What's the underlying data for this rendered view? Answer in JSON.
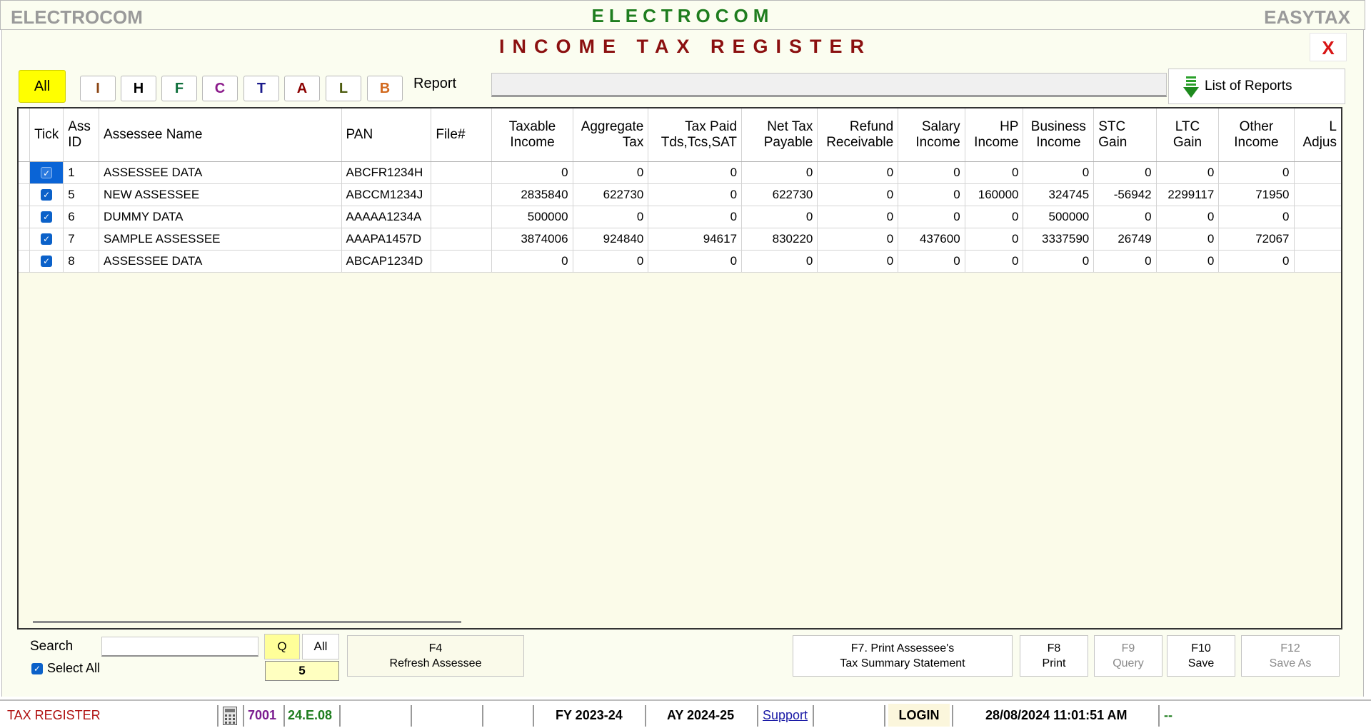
{
  "title_bar": {
    "left": "ELECTROCOM",
    "center": "ELECTROCOM",
    "right": "EASYTAX"
  },
  "register_title": "INCOME TAX REGISTER",
  "close_label": "X",
  "filters": {
    "all": "All",
    "letters": [
      {
        "label": "I",
        "color": "#8b4513"
      },
      {
        "label": "H",
        "color": "#000000"
      },
      {
        "label": "F",
        "color": "#0d6e3a"
      },
      {
        "label": "C",
        "color": "#8b1a8b"
      },
      {
        "label": "T",
        "color": "#1a1a8b"
      },
      {
        "label": "A",
        "color": "#8b0000"
      },
      {
        "label": "L",
        "color": "#4b5a0d"
      },
      {
        "label": "B",
        "color": "#d2691e"
      }
    ]
  },
  "report_label": "Report",
  "report_value": "",
  "list_reports_label": "List of Reports",
  "columns": [
    {
      "line1": "Tick",
      "line2": ""
    },
    {
      "line1": "Ass",
      "line2": "ID"
    },
    {
      "line1": "Assessee Name",
      "line2": ""
    },
    {
      "line1": "PAN",
      "line2": ""
    },
    {
      "line1": "File#",
      "line2": ""
    },
    {
      "line1": "Taxable",
      "line2": "Income"
    },
    {
      "line1": "Aggregate",
      "line2": "Tax"
    },
    {
      "line1": "Tax Paid",
      "line2": "Tds,Tcs,SAT"
    },
    {
      "line1": "Net Tax",
      "line2": "Payable"
    },
    {
      "line1": "Refund",
      "line2": "Receivable"
    },
    {
      "line1": "Salary",
      "line2": "Income"
    },
    {
      "line1": "HP",
      "line2": "Income"
    },
    {
      "line1": "Business",
      "line2": "Income"
    },
    {
      "line1": "STC",
      "line2": "Gain"
    },
    {
      "line1": "LTC",
      "line2": "Gain"
    },
    {
      "line1": "Other",
      "line2": "Income"
    },
    {
      "line1": "L",
      "line2": "Adjus"
    }
  ],
  "rows": [
    {
      "id": "1",
      "name": "ASSESSEE DATA",
      "pan": "ABCFR1234H",
      "file": "",
      "taxable": "0",
      "aggregate": "0",
      "paid": "0",
      "net": "0",
      "refund": "0",
      "salary": "0",
      "hp": "0",
      "business": "0",
      "stc": "0",
      "ltc": "0",
      "other": "0",
      "selected": true
    },
    {
      "id": "5",
      "name": "NEW ASSESSEE",
      "pan": "ABCCM1234J",
      "file": "",
      "taxable": "2835840",
      "aggregate": "622730",
      "paid": "0",
      "net": "622730",
      "refund": "0",
      "salary": "0",
      "hp": "160000",
      "business": "324745",
      "stc": "-56942",
      "ltc": "2299117",
      "other": "71950",
      "selected": false
    },
    {
      "id": "6",
      "name": "DUMMY DATA",
      "pan": "AAAAA1234A",
      "file": "",
      "taxable": "500000",
      "aggregate": "0",
      "paid": "0",
      "net": "0",
      "refund": "0",
      "salary": "0",
      "hp": "0",
      "business": "500000",
      "stc": "0",
      "ltc": "0",
      "other": "0",
      "selected": false
    },
    {
      "id": "7",
      "name": "SAMPLE ASSESSEE",
      "pan": "AAAPA1457D",
      "file": "",
      "taxable": "3874006",
      "aggregate": "924840",
      "paid": "94617",
      "net": "830220",
      "refund": "0",
      "salary": "437600",
      "hp": "0",
      "business": "3337590",
      "stc": "26749",
      "ltc": "0",
      "other": "72067",
      "selected": false
    },
    {
      "id": "8",
      "name": "ASSESSEE DATA",
      "pan": "ABCAP1234D",
      "file": "",
      "taxable": "0",
      "aggregate": "0",
      "paid": "0",
      "net": "0",
      "refund": "0",
      "salary": "0",
      "hp": "0",
      "business": "0",
      "stc": "0",
      "ltc": "0",
      "other": "0",
      "selected": false
    }
  ],
  "search": {
    "label": "Search",
    "value": "",
    "q_label": "Q",
    "all_label": "All",
    "count": "5",
    "select_all_label": "Select All"
  },
  "fkeys": {
    "f4": {
      "key": "F4",
      "label": "Refresh Assessee"
    },
    "f7": {
      "key": "F7. Print Assessee's",
      "label": "Tax Summary Statement"
    },
    "f8": {
      "key": "F8",
      "label": "Print"
    },
    "f9": {
      "key": "F9",
      "label": "Query"
    },
    "f10": {
      "key": "F10",
      "label": "Save"
    },
    "f12": {
      "key": "F12",
      "label": "Save As"
    }
  },
  "status": {
    "module": "TAX REGISTER",
    "code": "7001",
    "version": "24.E.08",
    "fy": "FY 2023-24",
    "ay": "AY 2024-25",
    "support": "Support",
    "login": "LOGIN",
    "datetime": "28/08/2024 11:01:51 AM",
    "tail": "--"
  },
  "colors": {
    "accent_yellow": "#ffff00",
    "title_green": "#1e7d1e",
    "title_red": "#8b1010",
    "selected_blue": "#0a64d6"
  }
}
